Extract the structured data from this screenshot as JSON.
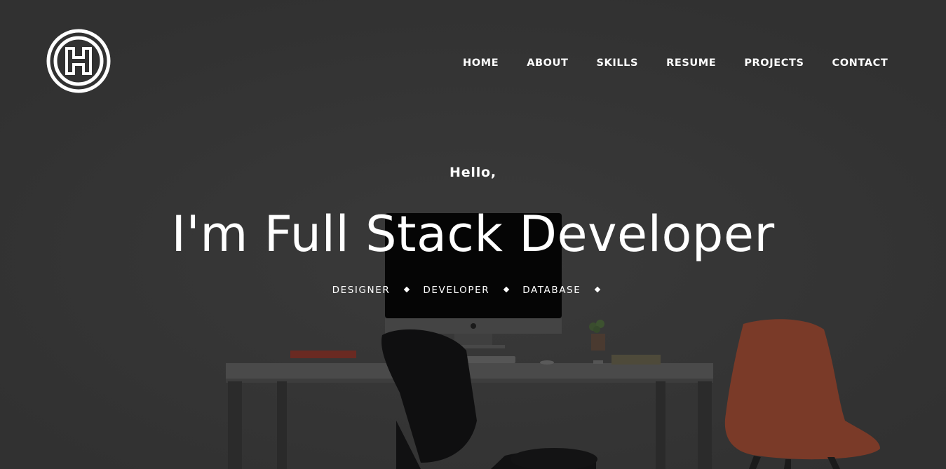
{
  "logo": {
    "letter": "H",
    "icon": "h-circle-logo-icon"
  },
  "nav": {
    "items": [
      {
        "label": "HOME"
      },
      {
        "label": "ABOUT"
      },
      {
        "label": "SKILLS"
      },
      {
        "label": "RESUME"
      },
      {
        "label": "PROJECTS"
      },
      {
        "label": "CONTACT"
      }
    ]
  },
  "hero": {
    "greeting": "Hello,",
    "headline": "I'm Full Stack Developer",
    "roles": [
      "DESIGNER",
      "DEVELOPER",
      "DATABASE"
    ],
    "separator_icon": "diamond-icon"
  },
  "colors": {
    "overlay": "#323232",
    "text": "#ffffff",
    "chair_accent": "#7a3a28"
  }
}
